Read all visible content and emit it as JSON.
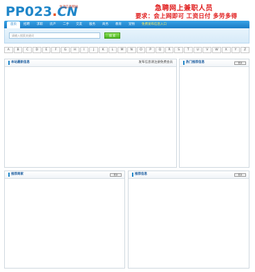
{
  "header": {
    "logo_main": "PP023",
    "logo_dot": ".",
    "logo_tld": "CN",
    "slogan": "生活信息网站",
    "ad_line1": "急聘网上兼职人员",
    "ad_line2": "要求：会上网即可  工资日付  多劳多得"
  },
  "nav": {
    "items": [
      {
        "label": "首页",
        "active": true
      },
      {
        "label": "招聘"
      },
      {
        "label": "求职"
      },
      {
        "label": "房产"
      },
      {
        "label": "二手"
      },
      {
        "label": "交友"
      },
      {
        "label": "服务"
      },
      {
        "label": "商务"
      },
      {
        "label": "教育"
      },
      {
        "label": "宠物"
      },
      {
        "label": "免费发布信息入口",
        "highlight": true
      }
    ]
  },
  "search": {
    "placeholder": "请输入搜索关键词",
    "button_label": "搜 索"
  },
  "letters": [
    "A",
    "B",
    "C",
    "D",
    "E",
    "F",
    "G",
    "H",
    "I",
    "J",
    "K",
    "L",
    "M",
    "N",
    "O",
    "P",
    "Q",
    "R",
    "S",
    "T",
    "U",
    "V",
    "W",
    "X",
    "Y",
    "Z"
  ],
  "panels": {
    "main": {
      "title": "本站最新信息",
      "note": "发布信息请注册免费会员"
    },
    "side": {
      "title": "热门推荐信息",
      "more": "更多"
    },
    "bottom_left": {
      "title": "推荐商家",
      "more": "更多"
    },
    "bottom_right": {
      "title": "推荐信息",
      "more": "更多"
    }
  },
  "colors": {
    "brand_blue": "#1f86c9",
    "ad_red": "#e01b1b",
    "search_button_green": "#4cb51f"
  }
}
